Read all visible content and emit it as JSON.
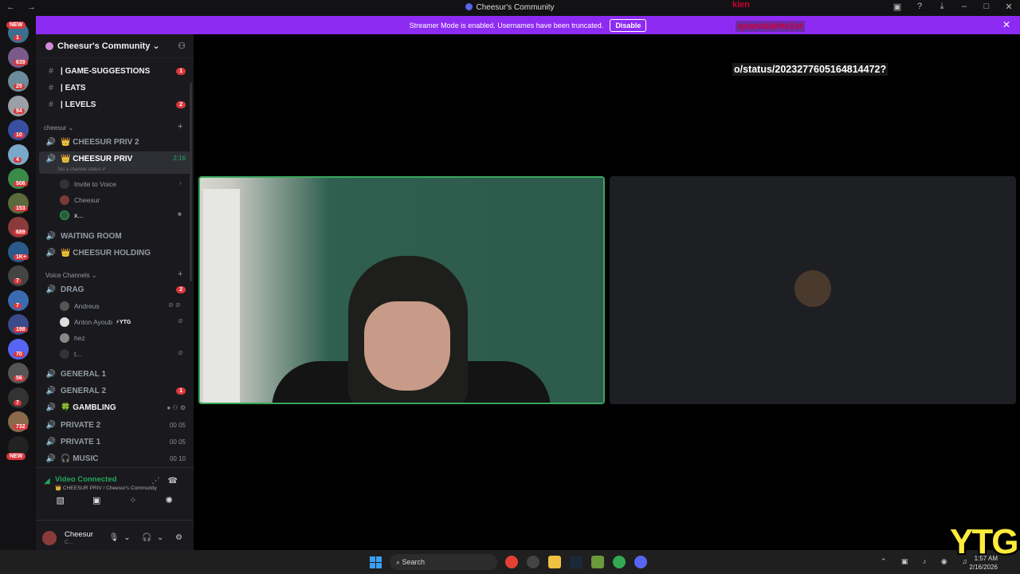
{
  "window": {
    "title": "Cheesur's Community",
    "nav": "← →"
  },
  "banner": {
    "text": "Streamer Mode is enabled. Usernames have been truncated.",
    "disable_label": "Disable"
  },
  "server_rail": {
    "badges": [
      "NEW",
      "1",
      "639",
      "29",
      "94",
      "10",
      "4",
      "506",
      "153",
      "689",
      "1K+",
      "7",
      "7",
      "198",
      "70",
      "56",
      "7",
      "732",
      "NEW"
    ]
  },
  "guild": {
    "name": "Cheesur's Community ⌄"
  },
  "text_channels": [
    {
      "label": "| GAME-SUGGESTIONS",
      "badge": "1"
    },
    {
      "label": "| EATS",
      "badge": ""
    },
    {
      "label": "| LEVELS",
      "badge": "2"
    }
  ],
  "category_cheesur": "cheesur ⌄",
  "voice_cheesur": [
    {
      "label": "👑 CHEESUR PRIV 2"
    },
    {
      "label": "👑 CHEESUR PRIV",
      "timer": "2:16",
      "status": "Set a channel status ✐"
    }
  ],
  "priv_members": [
    {
      "name": "Invite to Voice"
    },
    {
      "name": "Cheesur"
    },
    {
      "name": "x..."
    }
  ],
  "voice_more": [
    {
      "label": "WAITING ROOM"
    },
    {
      "label": "👑 CHEESUR HOLDING"
    }
  ],
  "category_voice": "Voice Channels ⌄",
  "drag": {
    "label": "DRAG",
    "badge": "2"
  },
  "drag_members": [
    {
      "name": "Andreus",
      "tag": ""
    },
    {
      "name": "Anton Ayoub",
      "tag": "⚡YTG"
    },
    {
      "name": "hez",
      "tag": ""
    },
    {
      "name": "t...",
      "tag": ""
    }
  ],
  "voice_list": [
    {
      "label": "GENERAL 1",
      "badge": "",
      "meta": ""
    },
    {
      "label": "GENERAL 2",
      "badge": "1",
      "meta": ""
    },
    {
      "label": "🍀 GAMBLING",
      "badge": "",
      "meta": ""
    },
    {
      "label": "PRIVATE 2",
      "badge": "",
      "meta": "00  05"
    },
    {
      "label": "PRIVATE 1",
      "badge": "",
      "meta": "00  05"
    },
    {
      "label": "🎧 MUSIC",
      "badge": "",
      "meta": "00  10"
    }
  ],
  "voice_connection": {
    "status": "Video Connected",
    "channel": "👑 CHEESUR PRIV / Cheesur's Community"
  },
  "user_panel": {
    "name": "Cheesur",
    "status": "C..."
  },
  "overlay": {
    "line1": "kien",
    "line2": "quandalethe1st",
    "url": "o/status/2023277605164814472?"
  },
  "taskbar": {
    "search_placeholder": "Search",
    "time": "1:57 AM",
    "date": "2/16/2026"
  },
  "watermark": "YTG",
  "colors": {
    "banner": "#8e2bf3",
    "connected_green": "#23a55a",
    "badge_red": "#da373c",
    "watermark_yellow": "#ffeb3b"
  }
}
